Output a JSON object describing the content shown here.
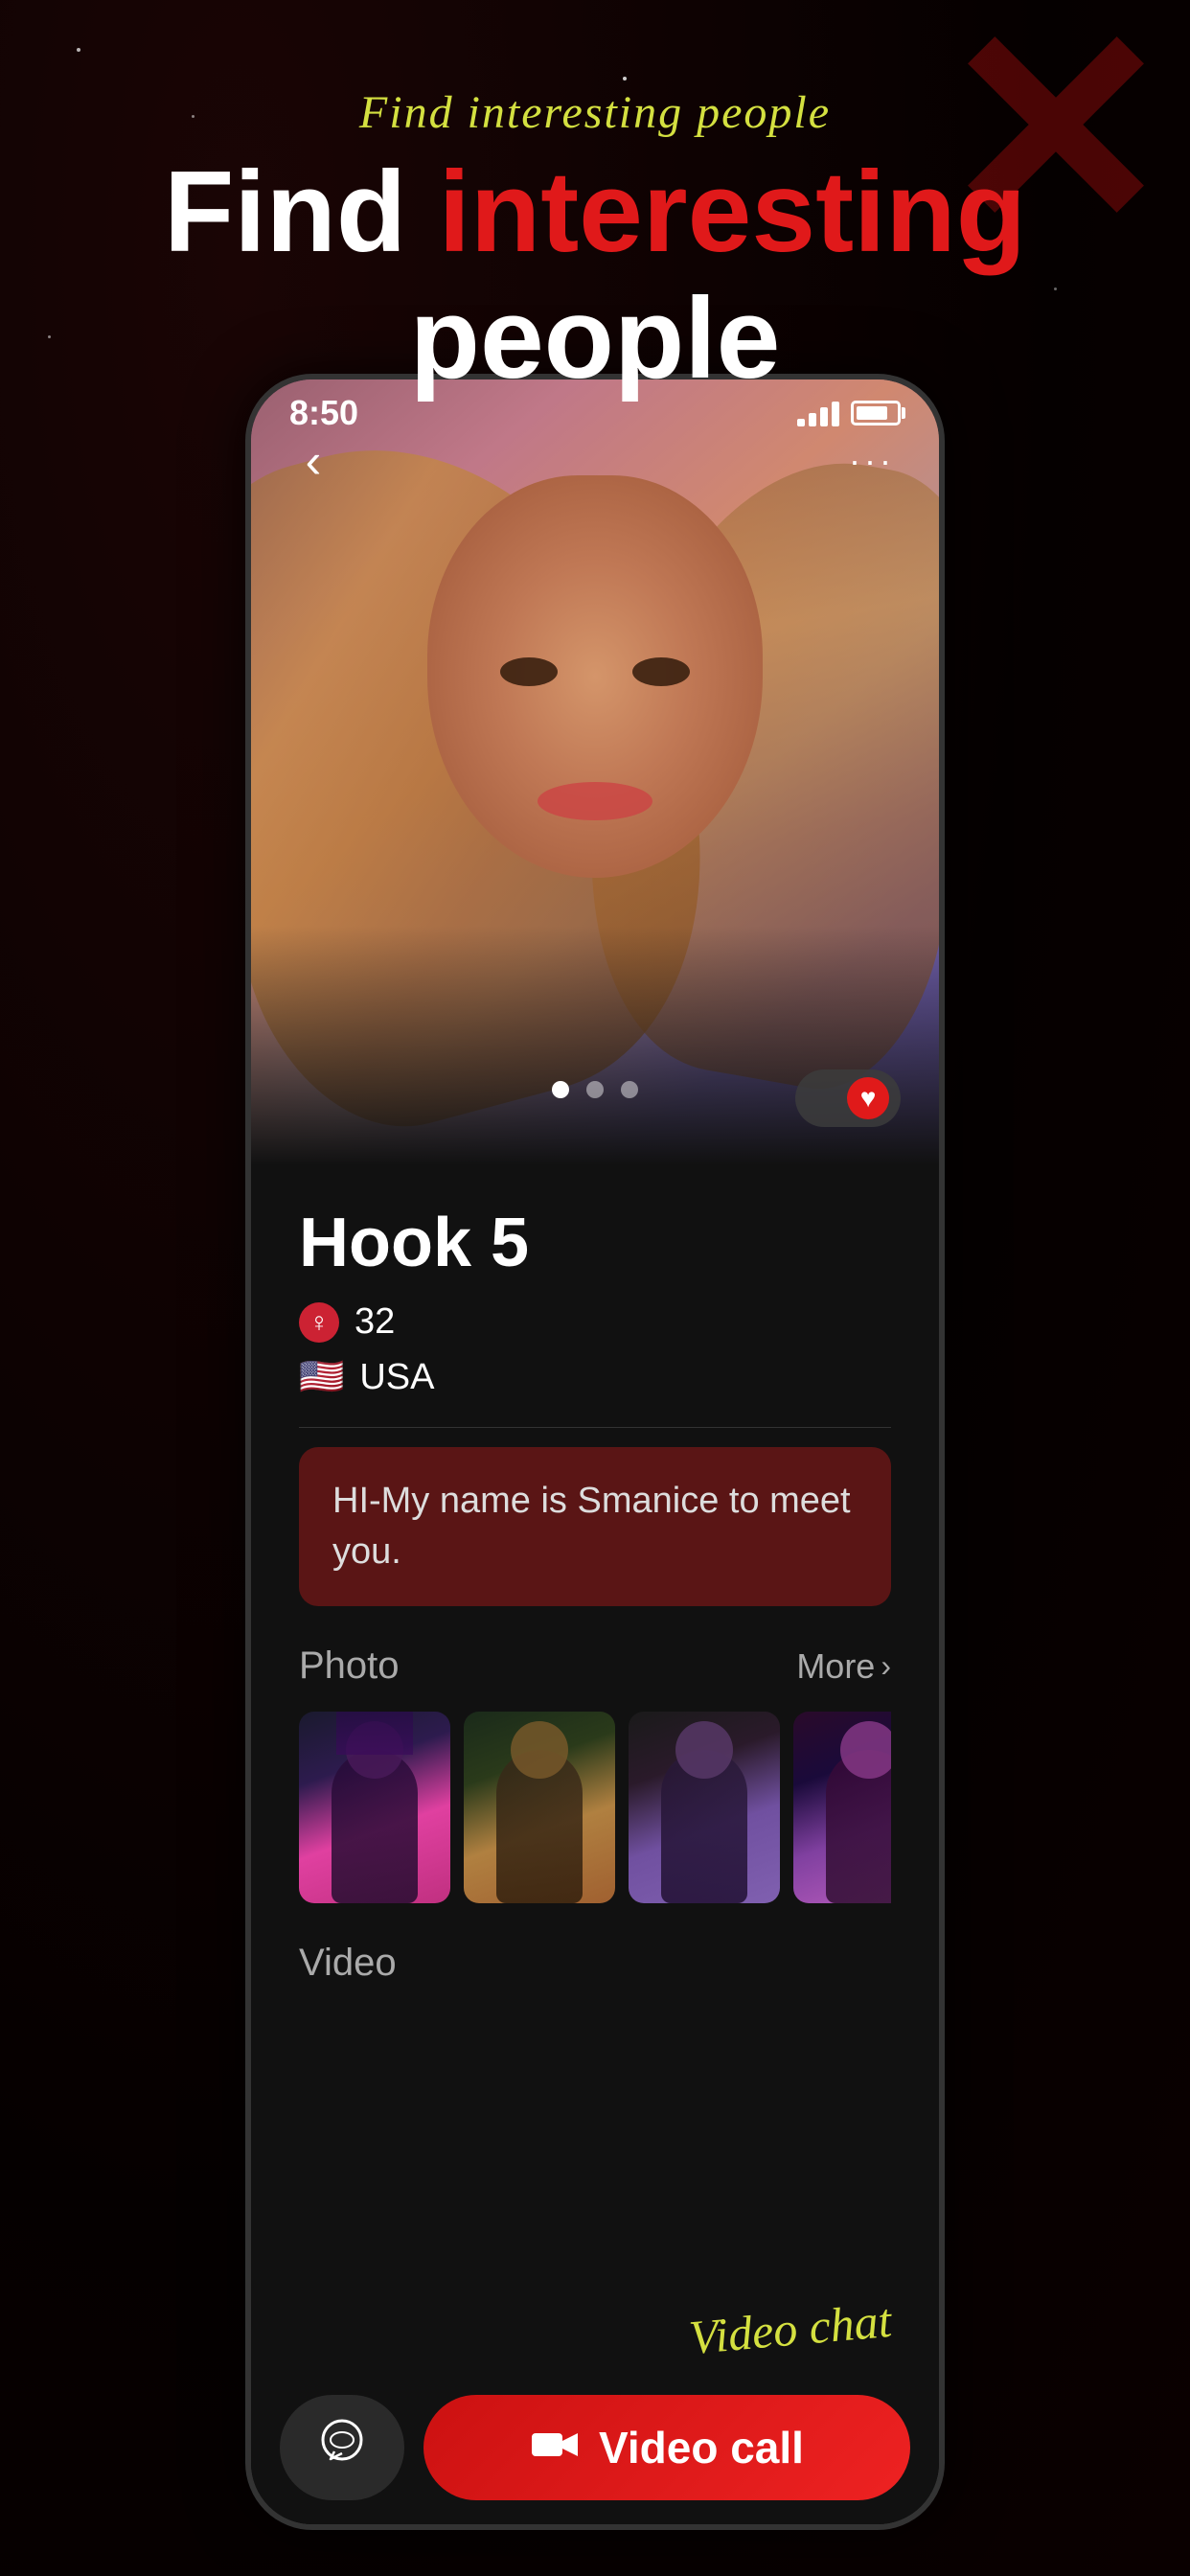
{
  "background": {
    "color": "#0a0000"
  },
  "headline": {
    "cursive": "Find interesting people",
    "main_white": "Find",
    "main_red": "interesting",
    "main_second_line": "people"
  },
  "status_bar": {
    "time": "8:50",
    "signal_label": "signal bars",
    "battery_label": "battery"
  },
  "profile": {
    "name": "Hook 5",
    "age": "32",
    "country": "USA",
    "country_flag": "🇺🇸",
    "gender_symbol": "♀",
    "bio": "HI-My name is Smanice to meet you.",
    "photo_count": 3,
    "active_dot": 0
  },
  "sections": {
    "photo": {
      "title": "Photo",
      "more_label": "More",
      "more_chevron": "›"
    },
    "video": {
      "title": "Video",
      "cursive_label": "Video chat"
    }
  },
  "navigation": {
    "back_label": "‹",
    "more_dots": "···"
  },
  "buttons": {
    "video_call": "Video call",
    "chat_icon": "💬"
  },
  "heart": {
    "icon": "♥"
  },
  "photo_dots": [
    {
      "active": true
    },
    {
      "active": false
    },
    {
      "active": false
    }
  ],
  "photo_thumbnails": [
    {
      "label": "photo-1",
      "style_class": "photo-thumb-1"
    },
    {
      "label": "photo-2",
      "style_class": "photo-thumb-2"
    },
    {
      "label": "photo-3",
      "style_class": "photo-thumb-3"
    },
    {
      "label": "photo-4",
      "style_class": "photo-thumb-4"
    }
  ]
}
